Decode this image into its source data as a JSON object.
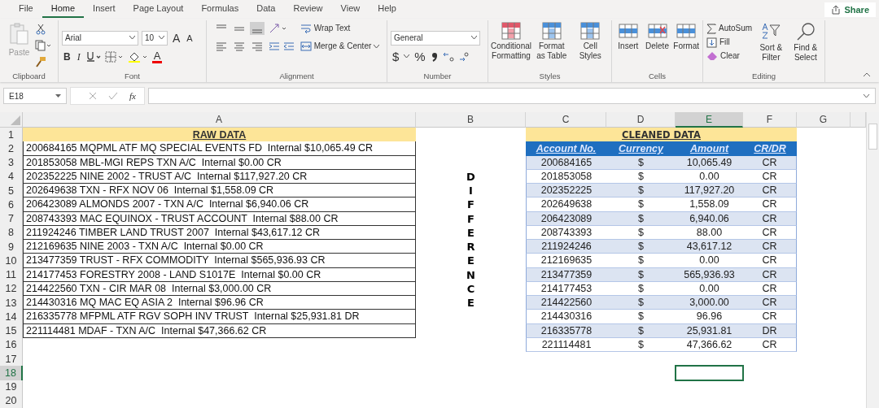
{
  "menu_tabs": [
    {
      "label": "File",
      "selected": false
    },
    {
      "label": "Home",
      "selected": true
    },
    {
      "label": "Insert",
      "selected": false
    },
    {
      "label": "Page Layout",
      "selected": false
    },
    {
      "label": "Formulas",
      "selected": false
    },
    {
      "label": "Data",
      "selected": false
    },
    {
      "label": "Review",
      "selected": false
    },
    {
      "label": "View",
      "selected": false
    },
    {
      "label": "Help",
      "selected": false
    }
  ],
  "share_button": "Share",
  "clipboard": {
    "paste": "Paste",
    "label": "Clipboard"
  },
  "font": {
    "name": "Arial",
    "size": "10",
    "grow": "A",
    "shrink": "A",
    "bold": "B",
    "italic": "I",
    "font_color": "A",
    "label": "Font"
  },
  "alignment": {
    "wrap": "Wrap Text",
    "merge": "Merge & Center",
    "label": "Alignment"
  },
  "number": {
    "format": "General",
    "currency": "$",
    "percent": "%",
    "label": "Number"
  },
  "styles": {
    "buttons": [
      "Conditional Formatting",
      "Format as Table",
      "Cell Styles"
    ],
    "label": "Styles"
  },
  "cells": {
    "buttons": [
      "Insert",
      "Delete",
      "Format"
    ],
    "label": "Cells"
  },
  "editing": {
    "autosum": "AutoSum",
    "fill": "Fill",
    "clear": "Clear",
    "sort": "Sort & Filter",
    "find": "Find & Select",
    "label": "Editing"
  },
  "formula_bar": {
    "name_box": "E18",
    "function_label": "fx"
  },
  "columns": [
    {
      "label": "A",
      "selected": false
    },
    {
      "label": "B",
      "selected": false
    },
    {
      "label": "C",
      "selected": false
    },
    {
      "label": "D",
      "selected": false
    },
    {
      "label": "E",
      "selected": true
    },
    {
      "label": "F",
      "selected": false
    },
    {
      "label": "G",
      "selected": false
    }
  ],
  "rows": [
    {
      "label": "1",
      "selected": false
    },
    {
      "label": "2",
      "selected": false
    },
    {
      "label": "3",
      "selected": false
    },
    {
      "label": "4",
      "selected": false
    },
    {
      "label": "5",
      "selected": false
    },
    {
      "label": "6",
      "selected": false
    },
    {
      "label": "7",
      "selected": false
    },
    {
      "label": "8",
      "selected": false
    },
    {
      "label": "9",
      "selected": false
    },
    {
      "label": "10",
      "selected": false
    },
    {
      "label": "11",
      "selected": false
    },
    {
      "label": "12",
      "selected": false
    },
    {
      "label": "13",
      "selected": false
    },
    {
      "label": "14",
      "selected": false
    },
    {
      "label": "15",
      "selected": false
    },
    {
      "label": "16",
      "selected": false
    },
    {
      "label": "17",
      "selected": false
    },
    {
      "label": "18",
      "selected": true
    },
    {
      "label": "19",
      "selected": false
    },
    {
      "label": "20",
      "selected": false
    }
  ],
  "raw_data": {
    "title": "RAW DATA",
    "lines": [
      "200684165 MQPML ATF MQ SPECIAL EVENTS FD  Internal $10,065.49 CR",
      "201853058 MBL-MGI REPS TXN A/C  Internal $0.00 CR",
      "202352225 NINE 2002 - TRUST A/C  Internal $117,927.20 CR",
      "202649638 TXN - RFX NOV 06  Internal $1,558.09 CR",
      "206423089 ALMONDS 2007 - TXN A/C  Internal $6,940.06 CR",
      "208743393 MAC EQUINOX - TRUST ACCOUNT  Internal $88.00 CR",
      "211924246 TIMBER LAND TRUST 2007  Internal $43,617.12 CR",
      "212169635 NINE 2003 - TXN A/C  Internal $0.00 CR",
      "213477359 TRUST - RFX COMMODITY  Internal $565,936.93 CR",
      "214177453 FORESTRY 2008 - LAND S1017E  Internal $0.00 CR",
      "214422560 TXN - CIR MAR 08  Internal $3,000.00 CR",
      "214430316 MQ MAC EQ ASIA 2  Internal $96.96 CR",
      "216335778 MFPML ATF RGV SOPH INV TRUST  Internal $25,931.81 DR",
      "221114481 MDAF - TXN A/C  Internal $47,366.62 CR"
    ]
  },
  "vertical_label": "DIFFERENCE",
  "cleaned_data": {
    "title": "CLEANED DATA",
    "headers": [
      "Account No.",
      "Currency",
      "Amount",
      "CR/DR"
    ],
    "rows": [
      [
        "200684165",
        "$",
        "10,065.49",
        "CR"
      ],
      [
        "201853058",
        "$",
        "0.00",
        "CR"
      ],
      [
        "202352225",
        "$",
        "117,927.20",
        "CR"
      ],
      [
        "202649638",
        "$",
        "1,558.09",
        "CR"
      ],
      [
        "206423089",
        "$",
        "6,940.06",
        "CR"
      ],
      [
        "208743393",
        "$",
        "88.00",
        "CR"
      ],
      [
        "211924246",
        "$",
        "43,617.12",
        "CR"
      ],
      [
        "212169635",
        "$",
        "0.00",
        "CR"
      ],
      [
        "213477359",
        "$",
        "565,936.93",
        "CR"
      ],
      [
        "214177453",
        "$",
        "0.00",
        "CR"
      ],
      [
        "214422560",
        "$",
        "3,000.00",
        "CR"
      ],
      [
        "214430316",
        "$",
        "96.96",
        "CR"
      ],
      [
        "216335778",
        "$",
        "25,931.81",
        "DR"
      ],
      [
        "221114481",
        "$",
        "47,366.62",
        "CR"
      ]
    ]
  }
}
